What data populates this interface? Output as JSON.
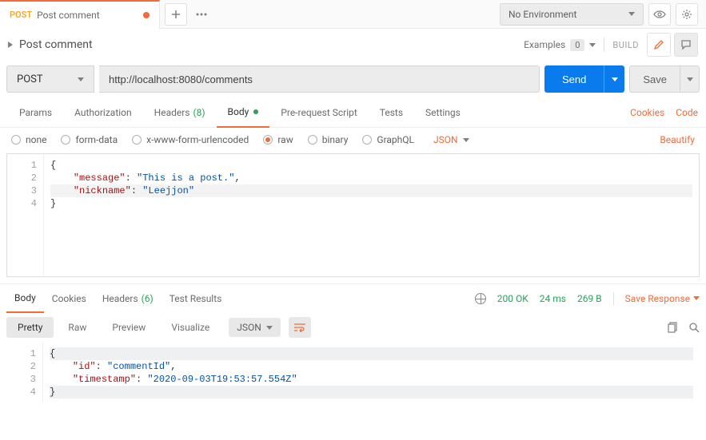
{
  "tab": {
    "method": "POST",
    "name": "Post comment"
  },
  "env": {
    "label": "No Environment"
  },
  "request": {
    "title": "Post comment",
    "examples_label": "Examples",
    "examples_count": "0",
    "build_label": "BUILD",
    "method": "POST",
    "url": "http://localhost:8080/comments",
    "send_label": "Send",
    "save_label": "Save"
  },
  "req_tabs": {
    "params": "Params",
    "authorization": "Authorization",
    "headers": "Headers",
    "headers_count": "(8)",
    "body": "Body",
    "prerequest": "Pre-request Script",
    "tests": "Tests",
    "settings": "Settings",
    "cookies": "Cookies",
    "code": "Code"
  },
  "body_types": {
    "none": "none",
    "formdata": "form-data",
    "urlencoded": "x-www-form-urlencoded",
    "raw": "raw",
    "binary": "binary",
    "graphql": "GraphQL",
    "content_type": "JSON",
    "beautify": "Beautify"
  },
  "request_body": {
    "k1": "\"message\"",
    "v1": "\"This is a post.\"",
    "k2": "\"nickname\"",
    "v2": "\"Leejjon\""
  },
  "resp_tabs": {
    "body": "Body",
    "cookies": "Cookies",
    "headers": "Headers",
    "headers_count": "(6)",
    "test_results": "Test Results"
  },
  "resp_meta": {
    "status": "200 OK",
    "time": "24 ms",
    "size": "269 B",
    "save_response": "Save Response"
  },
  "resp_toolbar": {
    "pretty": "Pretty",
    "raw": "Raw",
    "preview": "Preview",
    "visualize": "Visualize",
    "format": "JSON"
  },
  "response_body": {
    "k1": "\"id\"",
    "v1": "\"commentId\"",
    "k2": "\"timestamp\"",
    "v2": "\"2020-09-03T19:53:57.554Z\""
  }
}
